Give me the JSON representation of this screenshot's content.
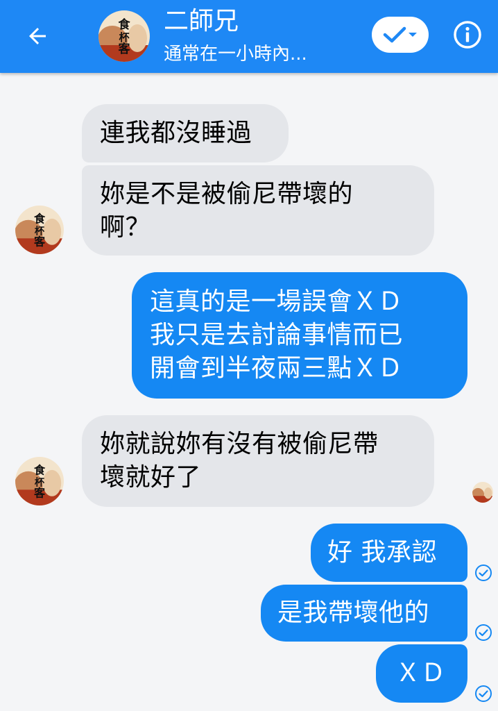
{
  "header": {
    "title": "二師兄",
    "subtitle": "通常在一小時內...",
    "back_icon": "arrow-left-icon",
    "status_icon": "check-dropdown-icon",
    "info_icon": "info-icon",
    "color": "#1e88f5"
  },
  "avatar": {
    "logo_text": [
      "食",
      "杯",
      "客"
    ]
  },
  "messages": [
    {
      "sender": "them",
      "lines": [
        "連我都沒睡過"
      ]
    },
    {
      "sender": "them",
      "lines": [
        "妳是不是被偷尼帶壞的",
        "啊？"
      ]
    },
    {
      "sender": "me",
      "lines": [
        "這真的是一場誤會ＸＤ",
        "我只是去討論事情而已",
        "開會到半夜兩三點ＸＤ"
      ]
    },
    {
      "sender": "them",
      "lines": [
        "妳就說妳有沒有被偷尼帶",
        "壞就好了"
      ]
    },
    {
      "sender": "me",
      "lines": [
        "好 我承認"
      ]
    },
    {
      "sender": "me",
      "lines": [
        "是我帶壞他的"
      ]
    },
    {
      "sender": "me",
      "lines": [
        "ＸＤ"
      ]
    }
  ],
  "colors": {
    "incoming_bubble": "#e4e6ea",
    "outgoing_bubble": "#1588f3",
    "background": "#f4f5f7"
  }
}
